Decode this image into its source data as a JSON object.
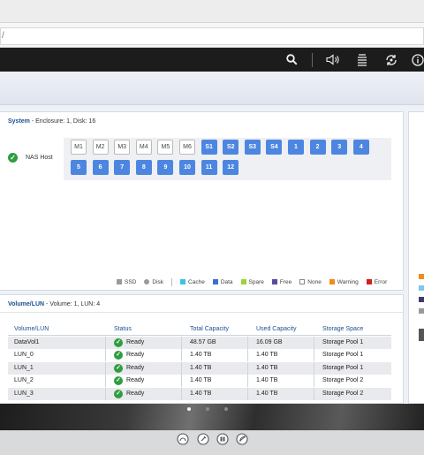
{
  "browser": {
    "url_fragment": "/"
  },
  "header_icons": [
    {
      "name": "search-icon",
      "glyph": "🔍"
    },
    {
      "name": "speaker-icon",
      "glyph": "🔊"
    },
    {
      "name": "tasks-icon",
      "glyph": "☰"
    },
    {
      "name": "sync-icon",
      "glyph": "⟳"
    },
    {
      "name": "info-icon",
      "glyph": "ⓘ"
    }
  ],
  "system_panel": {
    "title": "System",
    "meta": " - Enclosure: 1, Disk: 16",
    "host_label": "NAS Host",
    "slots_row1": [
      "M1",
      "M2",
      "M3",
      "M4",
      "M5",
      "M6",
      "S1",
      "S2",
      "S3",
      "S4",
      "1",
      "2",
      "3",
      "4"
    ],
    "slots_row2": [
      "5",
      "6",
      "7",
      "8",
      "9",
      "10",
      "11",
      "12"
    ],
    "legend": [
      {
        "label": "SSD",
        "color": "#9a9a9a",
        "shape": "square"
      },
      {
        "label": "Disk",
        "color": "#9a9a9a",
        "shape": "round"
      },
      {
        "label": "Cache",
        "color": "#3cc2e4",
        "shape": "square"
      },
      {
        "label": "Data",
        "color": "#3b6fd1",
        "shape": "square"
      },
      {
        "label": "Spare",
        "color": "#9bd33a",
        "shape": "square"
      },
      {
        "label": "Free",
        "color": "#5b4a9e",
        "shape": "square"
      },
      {
        "label": "None",
        "color": "#ffffff",
        "shape": "square"
      },
      {
        "label": "Warning",
        "color": "#f08a1c",
        "shape": "square"
      },
      {
        "label": "Error",
        "color": "#d21f1f",
        "shape": "square"
      }
    ]
  },
  "volume_panel": {
    "title": "Volume/LUN",
    "meta": " - Volume: 1, LUN: 4",
    "columns": [
      "Volume/LUN",
      "Status",
      "Total Capacity",
      "Used Capacity",
      "Storage Space"
    ],
    "rows": [
      {
        "name": "DataVol1",
        "status": "Ready",
        "total": "48.57 GB",
        "used": "16.09 GB",
        "space": "Storage Pool 1"
      },
      {
        "name": "LUN_0",
        "status": "Ready",
        "total": "1.40 TB",
        "used": "1.40 TB",
        "space": "Storage Pool 1"
      },
      {
        "name": "LUN_1",
        "status": "Ready",
        "total": "1.40 TB",
        "used": "1.40 TB",
        "space": "Storage Pool 1"
      },
      {
        "name": "LUN_2",
        "status": "Ready",
        "total": "1.40 TB",
        "used": "1.40 TB",
        "space": "Storage Pool 2"
      },
      {
        "name": "LUN_3",
        "status": "Ready",
        "total": "1.40 TB",
        "used": "1.40 TB",
        "space": "Storage Pool 2"
      }
    ]
  },
  "right_panel": {
    "legend_colors": [
      "#f08a1c",
      "#7ec8e8",
      "#3d3a6b",
      "#9a9a9a",
      "#555555"
    ]
  },
  "footer": {
    "dots": [
      true,
      false,
      false
    ]
  },
  "colors": {
    "accent": "#4d86e0",
    "ok": "#2e9e3e",
    "header_bg": "#1c1c1c"
  }
}
